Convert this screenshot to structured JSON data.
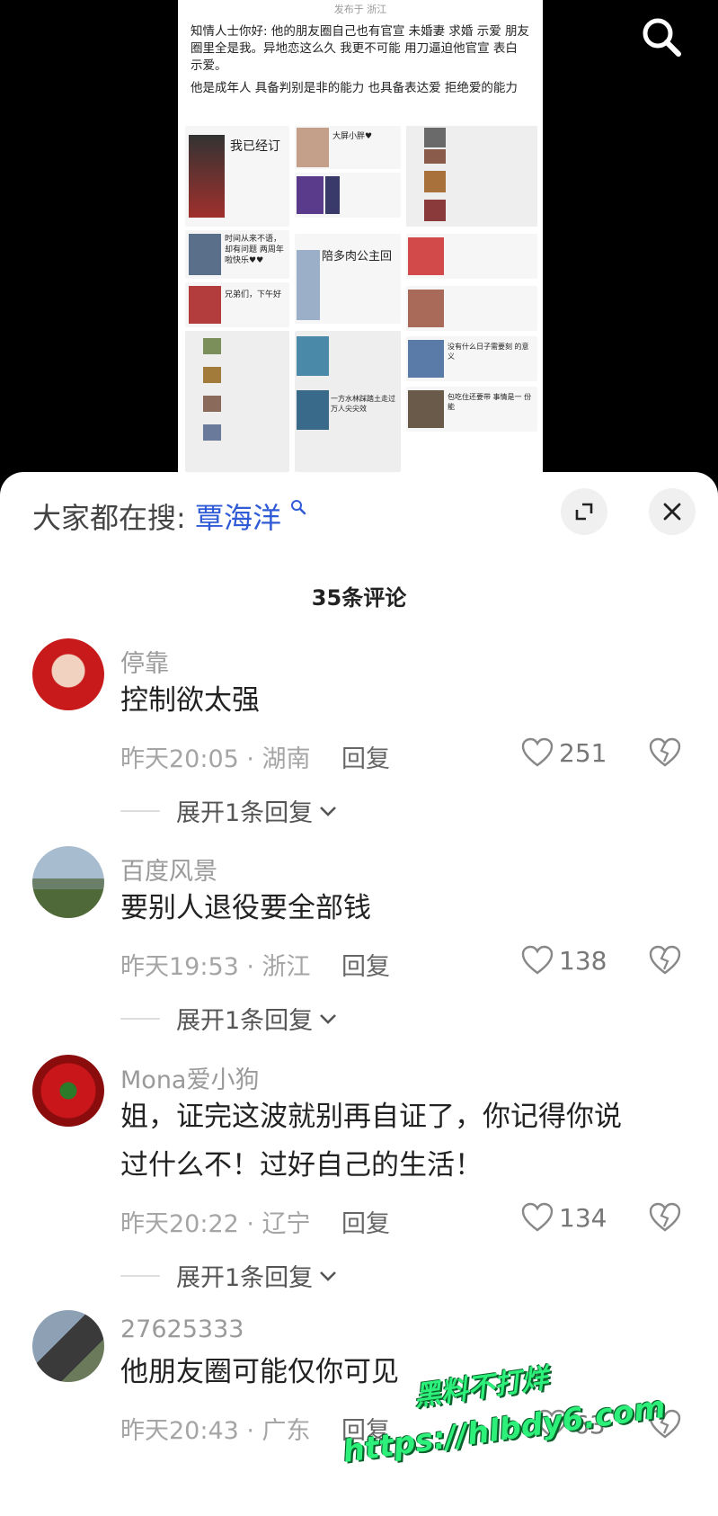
{
  "post": {
    "header": "发布于 浙江",
    "para1": "知情人士你好: 他的朋友圈自己也有官宣 未婚妻 求婚 示爱 朋友圈里全是我。异地恋这么久 我更不可能 用刀逼迫他官宣 表白 示爱。",
    "para2": "他是成年人 具备判别是非的能力 也具备表达爱 拒绝爱的能力",
    "card1": "我已经订",
    "card2": "大屏小胖♥",
    "card3": "陪多肉公主回",
    "card4": "时间从来不语，却有问题 两周年啦快乐♥♥",
    "card5": "兄弟们，下午好",
    "card6": "一方水林踩踏土走过 万人尖尖效",
    "card7": "没有什么日子需要刻 的意义",
    "card8": "包吃住还要带 事情是一 份能"
  },
  "search": {
    "label": "大家都在搜:",
    "keyword": "覃海洋"
  },
  "comments_count": "35条评论",
  "comments": [
    {
      "name": "停靠",
      "text": "控制欲太强",
      "meta": "昨天20:05 · 湖南",
      "reply": "回复",
      "likes": "251",
      "expand": "展开1条回复"
    },
    {
      "name": "百度风景",
      "text": "要别人退役要全部钱",
      "meta": "昨天19:53 · 浙江",
      "reply": "回复",
      "likes": "138",
      "expand": "展开1条回复"
    },
    {
      "name": "Mona爱小狗",
      "text1": "姐，证完这波就别再自证了，你记得你说",
      "text2": "过什么不！过好自己的生活！",
      "meta": "昨天20:22 · 辽宁",
      "reply": "回复",
      "likes": "134",
      "expand": "展开1条回复"
    },
    {
      "name": "27625333",
      "text": "他朋友圈可能仅你可见",
      "meta": "昨天20:43 · 广东",
      "reply": "回复",
      "likes": "63"
    }
  ],
  "watermark": {
    "line1": "黑料不打烊",
    "line2": "https://hlbdy6.com"
  },
  "colors": {
    "keyword": "#2f5bd7",
    "watermark": "#2df07a"
  },
  "icons": {
    "search": "search-icon",
    "expand": "expand-icon",
    "close": "close-icon",
    "like": "heart-icon",
    "dislike": "broken-heart-icon",
    "chevron": "chevron-down-icon"
  }
}
